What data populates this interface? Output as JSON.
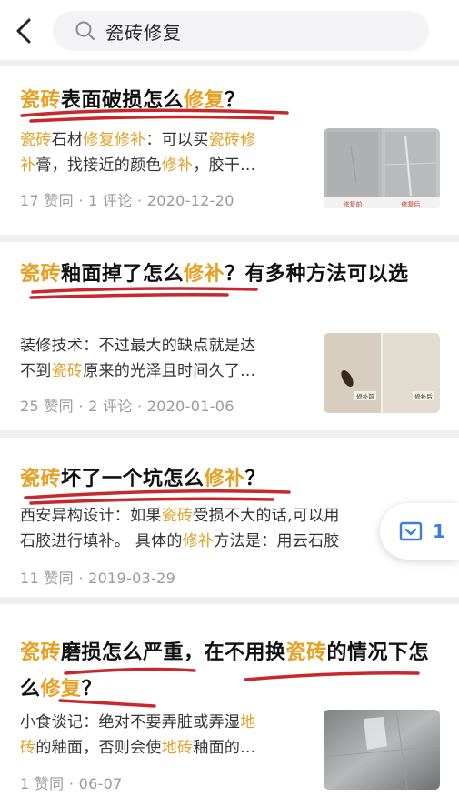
{
  "search": {
    "query": "瓷砖修复"
  },
  "results": [
    {
      "title_parts": [
        {
          "t": "瓷砖",
          "h": true
        },
        {
          "t": "表面破损怎么",
          "h": false
        },
        {
          "t": "修复",
          "h": true
        },
        {
          "t": "？",
          "h": false
        }
      ],
      "snippet_lines": [
        [
          {
            "t": "瓷砖",
            "h": true
          },
          {
            "t": "石材",
            "h": false
          },
          {
            "t": "修复修补",
            "h": true
          },
          {
            "t": "：可以买",
            "h": false
          },
          {
            "t": "瓷砖修",
            "h": true
          }
        ],
        [
          {
            "t": "补",
            "h": true
          },
          {
            "t": "膏，找接近的颜色",
            "h": false
          },
          {
            "t": "修补",
            "h": true
          },
          {
            "t": "，胶干...",
            "h": false
          }
        ]
      ],
      "meta": "17 赞同 · 1 评论 · 2020-12-20",
      "thumb_captions": [
        "修复前",
        "修复后"
      ]
    },
    {
      "title_parts": [
        {
          "t": "瓷砖",
          "h": true
        },
        {
          "t": "釉面掉了怎么",
          "h": false
        },
        {
          "t": "修补",
          "h": true
        },
        {
          "t": "？有多种方法可以选",
          "h": false
        }
      ],
      "snippet_lines": [
        [
          {
            "t": "装修技术：不过最大的缺点就是达",
            "h": false
          }
        ],
        [
          {
            "t": "不到",
            "h": false
          },
          {
            "t": "瓷砖",
            "h": true
          },
          {
            "t": "原来的光泽且时间久了...",
            "h": false
          }
        ]
      ],
      "meta": "25 赞同 · 2 评论 · 2020-01-06",
      "thumb_captions": [
        "修补前",
        "修补后"
      ]
    },
    {
      "title_parts": [
        {
          "t": "瓷砖",
          "h": true
        },
        {
          "t": "坏了一个坑怎么",
          "h": false
        },
        {
          "t": "修补",
          "h": true
        },
        {
          "t": "？",
          "h": false
        }
      ],
      "snippet_lines": [
        [
          {
            "t": "西安异构设计：如果",
            "h": false
          },
          {
            "t": "瓷砖",
            "h": true
          },
          {
            "t": "受损不大的话,可以用",
            "h": false
          }
        ],
        [
          {
            "t": "石胶进行填补。 具体的",
            "h": false
          },
          {
            "t": "修补",
            "h": true
          },
          {
            "t": "方法是：用云石胶",
            "h": false
          }
        ]
      ],
      "meta": "11 赞同 · 2019-03-29"
    },
    {
      "title_parts": [
        {
          "t": "瓷砖",
          "h": true
        },
        {
          "t": "磨损怎么严重，在不用换",
          "h": false
        },
        {
          "t": "瓷砖",
          "h": true
        },
        {
          "t": "的情况下怎么",
          "h": false
        },
        {
          "t": "修复",
          "h": true
        },
        {
          "t": "？",
          "h": false
        }
      ],
      "snippet_lines": [
        [
          {
            "t": "小食谈记：绝对不要弄脏或弄湿",
            "h": false
          },
          {
            "t": "地",
            "h": true
          }
        ],
        [
          {
            "t": "砖",
            "h": true
          },
          {
            "t": "的釉面，否则会使",
            "h": false
          },
          {
            "t": "地砖",
            "h": true
          },
          {
            "t": "釉面的...",
            "h": false
          }
        ]
      ],
      "meta": "1 赞同 · 06-07"
    }
  ],
  "floating_counter": {
    "count": "1"
  },
  "colors": {
    "highlight": "#e6a023",
    "accent": "#3a7de0",
    "ink": "#c8282c"
  }
}
